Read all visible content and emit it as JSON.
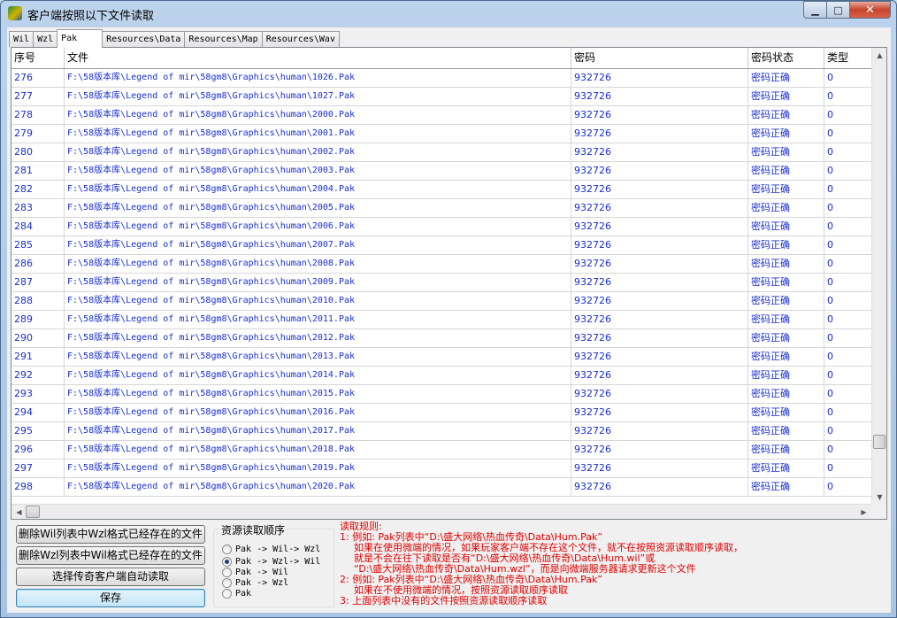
{
  "window": {
    "title": "客户端按照以下文件读取"
  },
  "tabs": [
    {
      "label": "Wil",
      "active": false
    },
    {
      "label": "Wzl",
      "active": false
    },
    {
      "label": "Pak",
      "active": true
    },
    {
      "label": "Resources\\Data",
      "active": false
    },
    {
      "label": "Resources\\Map",
      "active": false
    },
    {
      "label": "Resources\\Wav",
      "active": false
    }
  ],
  "grid": {
    "columns": [
      "序号",
      "文件",
      "密码",
      "密码状态",
      "类型"
    ],
    "rows": [
      [
        "276",
        "F:\\58版本库\\Legend of mir\\58gm8\\Graphics\\human\\1026.Pak",
        "932726",
        "密码正确",
        "0"
      ],
      [
        "277",
        "F:\\58版本库\\Legend of mir\\58gm8\\Graphics\\human\\1027.Pak",
        "932726",
        "密码正确",
        "0"
      ],
      [
        "278",
        "F:\\58版本库\\Legend of mir\\58gm8\\Graphics\\human\\2000.Pak",
        "932726",
        "密码正确",
        "0"
      ],
      [
        "279",
        "F:\\58版本库\\Legend of mir\\58gm8\\Graphics\\human\\2001.Pak",
        "932726",
        "密码正确",
        "0"
      ],
      [
        "280",
        "F:\\58版本库\\Legend of mir\\58gm8\\Graphics\\human\\2002.Pak",
        "932726",
        "密码正确",
        "0"
      ],
      [
        "281",
        "F:\\58版本库\\Legend of mir\\58gm8\\Graphics\\human\\2003.Pak",
        "932726",
        "密码正确",
        "0"
      ],
      [
        "282",
        "F:\\58版本库\\Legend of mir\\58gm8\\Graphics\\human\\2004.Pak",
        "932726",
        "密码正确",
        "0"
      ],
      [
        "283",
        "F:\\58版本库\\Legend of mir\\58gm8\\Graphics\\human\\2005.Pak",
        "932726",
        "密码正确",
        "0"
      ],
      [
        "284",
        "F:\\58版本库\\Legend of mir\\58gm8\\Graphics\\human\\2006.Pak",
        "932726",
        "密码正确",
        "0"
      ],
      [
        "285",
        "F:\\58版本库\\Legend of mir\\58gm8\\Graphics\\human\\2007.Pak",
        "932726",
        "密码正确",
        "0"
      ],
      [
        "286",
        "F:\\58版本库\\Legend of mir\\58gm8\\Graphics\\human\\2008.Pak",
        "932726",
        "密码正确",
        "0"
      ],
      [
        "287",
        "F:\\58版本库\\Legend of mir\\58gm8\\Graphics\\human\\2009.Pak",
        "932726",
        "密码正确",
        "0"
      ],
      [
        "288",
        "F:\\58版本库\\Legend of mir\\58gm8\\Graphics\\human\\2010.Pak",
        "932726",
        "密码正确",
        "0"
      ],
      [
        "289",
        "F:\\58版本库\\Legend of mir\\58gm8\\Graphics\\human\\2011.Pak",
        "932726",
        "密码正确",
        "0"
      ],
      [
        "290",
        "F:\\58版本库\\Legend of mir\\58gm8\\Graphics\\human\\2012.Pak",
        "932726",
        "密码正确",
        "0"
      ],
      [
        "291",
        "F:\\58版本库\\Legend of mir\\58gm8\\Graphics\\human\\2013.Pak",
        "932726",
        "密码正确",
        "0"
      ],
      [
        "292",
        "F:\\58版本库\\Legend of mir\\58gm8\\Graphics\\human\\2014.Pak",
        "932726",
        "密码正确",
        "0"
      ],
      [
        "293",
        "F:\\58版本库\\Legend of mir\\58gm8\\Graphics\\human\\2015.Pak",
        "932726",
        "密码正确",
        "0"
      ],
      [
        "294",
        "F:\\58版本库\\Legend of mir\\58gm8\\Graphics\\human\\2016.Pak",
        "932726",
        "密码正确",
        "0"
      ],
      [
        "295",
        "F:\\58版本库\\Legend of mir\\58gm8\\Graphics\\human\\2017.Pak",
        "932726",
        "密码正确",
        "0"
      ],
      [
        "296",
        "F:\\58版本库\\Legend of mir\\58gm8\\Graphics\\human\\2018.Pak",
        "932726",
        "密码正确",
        "0"
      ],
      [
        "297",
        "F:\\58版本库\\Legend of mir\\58gm8\\Graphics\\human\\2019.Pak",
        "932726",
        "密码正确",
        "0"
      ],
      [
        "298",
        "F:\\58版本库\\Legend of mir\\58gm8\\Graphics\\human\\2020.Pak",
        "932726",
        "密码正确",
        "0"
      ]
    ]
  },
  "buttons": {
    "delete_wil": "删除Wil列表中Wzl格式已经存在的文件",
    "delete_wzl": "删除Wzl列表中Wil格式已经存在的文件",
    "select_client": "选择传奇客户端自动读取",
    "save": "保存"
  },
  "read_order": {
    "title": "资源读取顺序",
    "options": [
      {
        "label": "Pak -> Wil-> Wzl",
        "selected": false
      },
      {
        "label": "Pak -> Wzl-> Wil",
        "selected": true
      },
      {
        "label": "Pak -> Wil",
        "selected": false
      },
      {
        "label": "Pak -> Wzl",
        "selected": false
      },
      {
        "label": "Pak",
        "selected": false
      }
    ]
  },
  "rules": {
    "title": "读取规则:",
    "lines": [
      "1: 例如: Pak列表中“D:\\盛大网络\\热血传奇\\Data\\Hum.Pak”",
      "如果在使用微端的情况，如果玩家客户端不存在这个文件，就不在按照资源读取顺序读取，",
      "就是不会在往下读取是否有“D:\\盛大网络\\热血传奇\\Data\\Hum.wil”或",
      "“D:\\盛大网络\\热血传奇\\Data\\Hum.wzl”，而是向微端服务器请求更新这个文件",
      "2: 例如: Pak列表中“D:\\盛大网络\\热血传奇\\Data\\Hum.Pak”",
      "如果在不使用微端的情况，按照资源读取顺序读取",
      "3: 上面列表中没有的文件按照资源读取顺序读取"
    ]
  },
  "colors": {
    "row_text": "#1a2fcc",
    "rules_text": "#e00000"
  }
}
